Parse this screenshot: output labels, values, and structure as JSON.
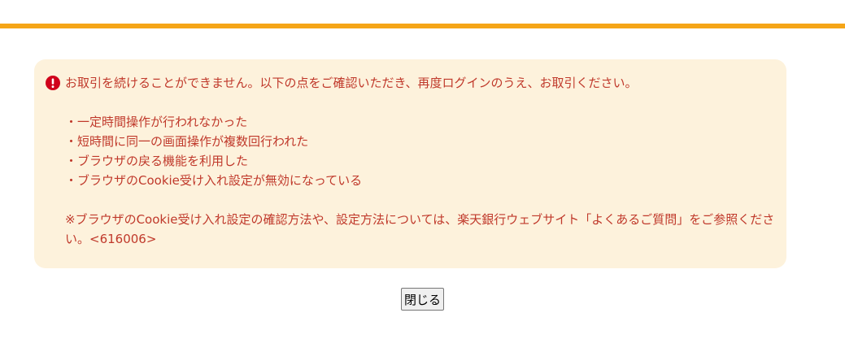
{
  "colors": {
    "accent_bar": "#f5a518",
    "error_box_bg": "#fdf2dc",
    "error_text": "#c0392b"
  },
  "error": {
    "icon": "exclamation-circle-icon",
    "message": "お取引を続けることができません。以下の点をご確認いただき、再度ログインのうえ、お取引ください。",
    "reasons": [
      "・一定時間操作が行われなかった",
      "・短時間に同一の画面操作が複数回行われた",
      "・ブラウザの戻る機能を利用した",
      "・ブラウザのCookie受け入れ設定が無効になっている"
    ],
    "note": "※ブラウザのCookie受け入れ設定の確認方法や、設定方法については、楽天銀行ウェブサイト「よくあるご質問」をご参照ください。<616006>"
  },
  "actions": {
    "close_label": "閉じる"
  }
}
